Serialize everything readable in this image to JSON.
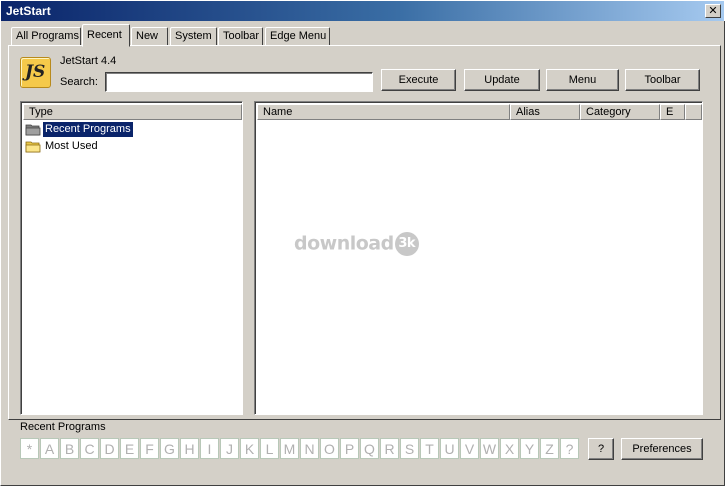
{
  "window": {
    "title": "JetStart",
    "close_glyph": "✕"
  },
  "tabs": [
    {
      "label": "All Programs",
      "active": false
    },
    {
      "label": "Recent",
      "active": true
    },
    {
      "label": "New",
      "active": false
    },
    {
      "label": "System",
      "active": false
    },
    {
      "label": "Toolbar",
      "active": false
    },
    {
      "label": "Edge Menu",
      "active": false
    }
  ],
  "header": {
    "logo_text": "JS",
    "app_name": "JetStart 4.4",
    "search_label": "Search:",
    "search_value": ""
  },
  "toolbar": {
    "execute": "Execute",
    "update": "Update",
    "menu": "Menu",
    "toolbar": "Toolbar"
  },
  "type_panel": {
    "header": "Type",
    "items": [
      {
        "label": "Recent Programs",
        "selected": true
      },
      {
        "label": "Most Used",
        "selected": false
      }
    ]
  },
  "programs_panel": {
    "columns": [
      "Name",
      "Alias",
      "Category",
      "E"
    ],
    "rows": []
  },
  "watermark": {
    "text": "download",
    "badge": "3k"
  },
  "status": {
    "current_view": "Recent Programs"
  },
  "letters": [
    "*",
    "A",
    "B",
    "C",
    "D",
    "E",
    "F",
    "G",
    "H",
    "I",
    "J",
    "K",
    "L",
    "M",
    "N",
    "O",
    "P",
    "Q",
    "R",
    "S",
    "T",
    "U",
    "V",
    "W",
    "X",
    "Y",
    "Z",
    "?"
  ],
  "footer": {
    "help": "?",
    "preferences": "Preferences"
  },
  "colors": {
    "selection": "#0a246a",
    "title_bar": "#0a246a",
    "face": "#d4d0c8"
  }
}
